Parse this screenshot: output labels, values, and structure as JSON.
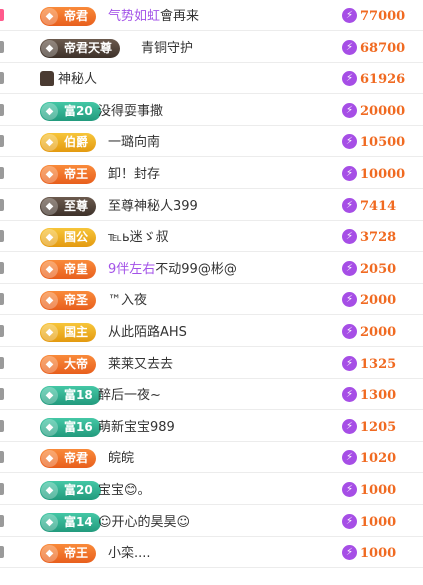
{
  "rows": [
    {
      "badge": "帝君",
      "badge_style": "orange",
      "name": "气势如虹",
      "name_suffix": "會再来",
      "name_color": "purple_prefix",
      "value": "77000",
      "hot": true
    },
    {
      "badge": "帝君天尊",
      "badge_style": "dark",
      "name": "青铜守护",
      "value": "68700"
    },
    {
      "badge": "",
      "badge_style": "avatar",
      "name": "神秘人",
      "value": "61926"
    },
    {
      "badge": "富20",
      "badge_style": "teal",
      "name": "没得耍事撒",
      "value": "20000"
    },
    {
      "badge": "伯爵",
      "badge_style": "gold",
      "name": "一璐向南",
      "value": "10500"
    },
    {
      "badge": "帝王",
      "badge_style": "orange",
      "name": "卸！封存",
      "value": "10000"
    },
    {
      "badge": "至尊",
      "badge_style": "dark",
      "name": "至尊神秘人399",
      "value": "7414"
    },
    {
      "badge": "国公",
      "badge_style": "gold",
      "name": "℡ь迷ゞ叔",
      "value": "3728"
    },
    {
      "badge": "帝皇",
      "badge_style": "orange",
      "name": "9伴左右",
      "name_suffix": "不动99@彬@",
      "name_color": "purple_prefix",
      "value": "2050"
    },
    {
      "badge": "帝圣",
      "badge_style": "orange",
      "name": "™入夜",
      "value": "2000"
    },
    {
      "badge": "国主",
      "badge_style": "gold",
      "name": "从此陌路AHS",
      "value": "2000"
    },
    {
      "badge": "大帝",
      "badge_style": "orange",
      "name": "莱莱又去去",
      "value": "1325"
    },
    {
      "badge": "富18",
      "badge_style": "teal",
      "name": "醉后一夜~",
      "value": "1300"
    },
    {
      "badge": "富16",
      "badge_style": "teal",
      "name": "萌新宝宝989",
      "value": "1205"
    },
    {
      "badge": "帝君",
      "badge_style": "orange",
      "name": "皖皖",
      "value": "1020"
    },
    {
      "badge": "富20",
      "badge_style": "teal",
      "name": "宝宝😊。",
      "value": "1000"
    },
    {
      "badge": "富14",
      "badge_style": "teal",
      "name": "☺开心的昊昊☺",
      "value": "1000"
    },
    {
      "badge": "帝王",
      "badge_style": "orange",
      "name": "小栾....",
      "value": "1000"
    }
  ],
  "colors": {
    "accent": "#f06a21",
    "gem": "#a64ee6",
    "name_purple": "#a352e8"
  }
}
